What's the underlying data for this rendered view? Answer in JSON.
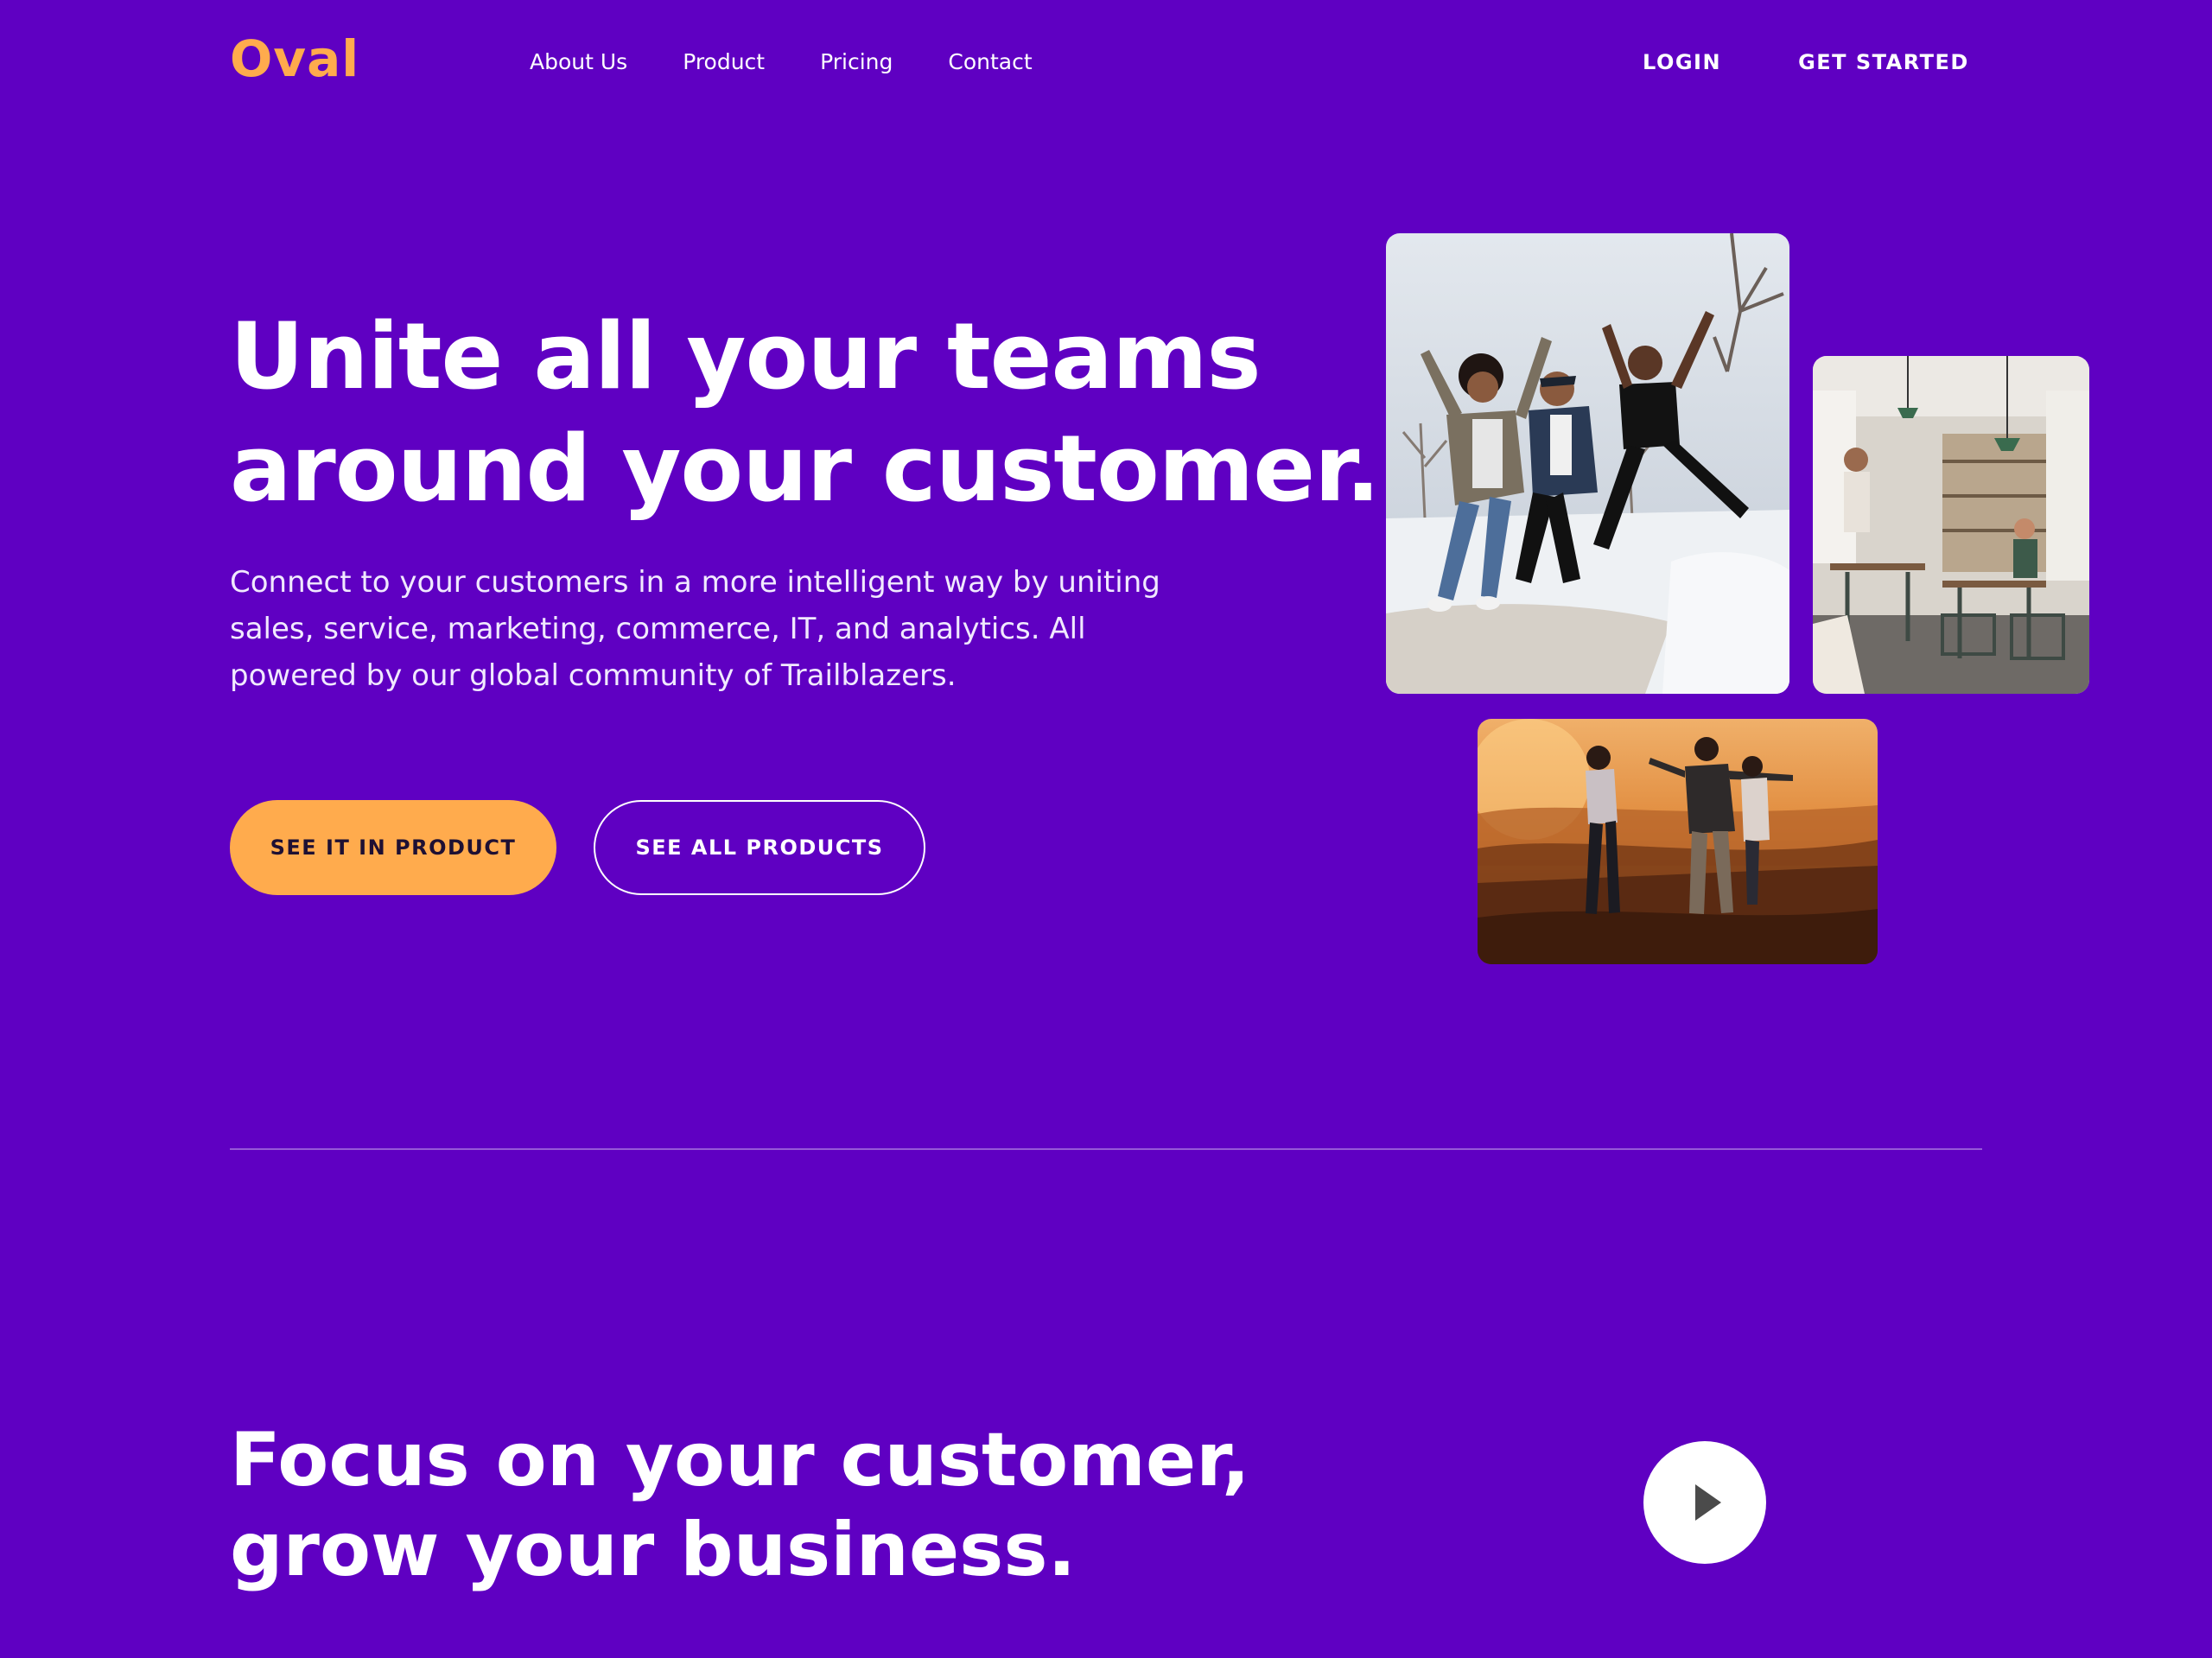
{
  "colors": {
    "background": "#5f00c2",
    "accent": "#ffab4d",
    "text": "#ffffff"
  },
  "nav": {
    "logo": "Oval",
    "links": [
      "About Us",
      "Product",
      "Pricing",
      "Contact"
    ],
    "login": "LOGIN",
    "get_started": "GET STARTED"
  },
  "hero": {
    "title_lines": [
      "Unite all your teams",
      "around your customer."
    ],
    "subtitle": "Connect to your customers in a more intelligent way by uniting sales, service, marketing, commerce, IT, and analytics. All powered by our global community of Trailblazers.",
    "primary_button": "SEE IT IN PRODUCT",
    "secondary_button": "SEE ALL PRODUCTS"
  },
  "photos": [
    {
      "subject": "three friends jumping in the snow"
    },
    {
      "subject": "busy cafe interior"
    },
    {
      "subject": "friends celebrating on a hill at sunset"
    }
  ],
  "section": {
    "title_lines": [
      "Focus on your customer,",
      "grow your business."
    ],
    "play_icon": "play-icon"
  }
}
